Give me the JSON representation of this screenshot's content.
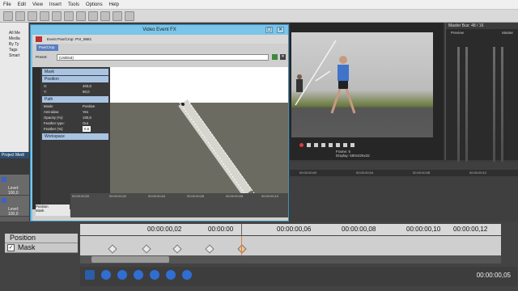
{
  "menu": [
    "File",
    "Edit",
    "View",
    "Insert",
    "Tools",
    "Options",
    "Help"
  ],
  "explorer": {
    "items": [
      "All Me",
      "Media",
      "By Ty",
      "Tags",
      "Smart"
    ],
    "panel_title": "Project Medi"
  },
  "tracks": [
    {
      "level": "Level: 100,0"
    },
    {
      "level": "Level: 100,0"
    }
  ],
  "dialog": {
    "title": "Video Event FX",
    "plugin_line": "Event Pan/Crop:  PVI_8681",
    "tab": "Pan/Crop",
    "preset_label": "Preset:",
    "preset_value": "(Untitled)",
    "sections": {
      "mask": "Mask",
      "position": "Position",
      "path": "Path",
      "workspace": "Workspace"
    },
    "position": {
      "x_label": "X:",
      "x": "403,0",
      "y_label": "Y:",
      "y": "90,0"
    },
    "path": {
      "mode_label": "Mode:",
      "mode": "Positive",
      "anti_alias_label": "Anti-alias:",
      "anti_alias": "Yes",
      "opacity_label": "Opacity (%):",
      "opacity": "100,0",
      "feather_type_label": "Feather type:",
      "feather_type": "Out",
      "feather_label": "Feather (%):",
      "feather": "0,5"
    },
    "kf_ticks": [
      "00:00:00;00",
      "00:00:00;02",
      "00:00:00;04",
      "00:00:00;06",
      "00:00:00;08",
      "00:00:00;10"
    ],
    "kf_tracks": [
      "Position",
      "Mask"
    ]
  },
  "preview": {
    "frame_label": "Frame:",
    "frame": "5",
    "display_label": "Display:",
    "display": "580x326x32"
  },
  "master": {
    "title": "Master Bus: 48 / 16",
    "preview": "Preview",
    "master": "Master"
  },
  "timeline_small_ticks": [
    "00:00:00;00",
    "00:00:00;04",
    "00:00:00;08",
    "00:00:00;12"
  ],
  "bottom": {
    "labels": {
      "position": "Position",
      "mask": "Mask"
    },
    "ruler": [
      "00:00:00",
      "00:00:00,02",
      "00:00:00,04",
      "00:00:00,06",
      "00:00:00,08",
      "00:00:00,10",
      "00:00:00,12"
    ],
    "timecode": "00:00:00,05"
  }
}
